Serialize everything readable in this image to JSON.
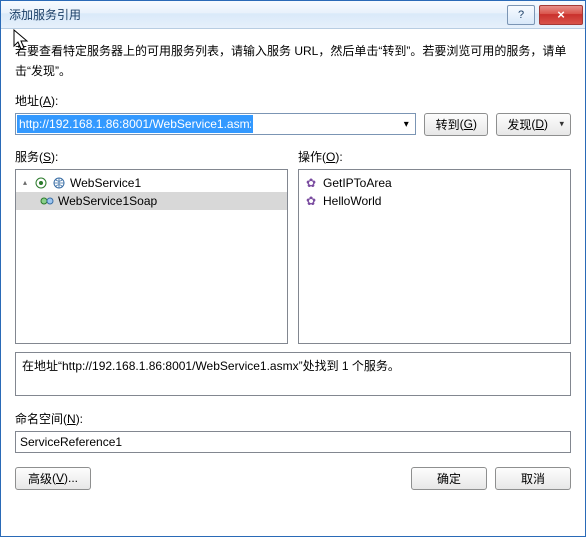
{
  "titlebar": {
    "title": "添加服务引用",
    "help_symbol": "?",
    "close_symbol": "×"
  },
  "intro": "若要查看特定服务器上的可用服务列表，请输入服务 URL，然后单击“转到”。若要浏览可用的服务，请单击“发现”。",
  "address": {
    "label_text": "地址",
    "label_key": "A",
    "value": "http://192.168.1.86:8001/WebService1.asmx",
    "go_label": "转到",
    "go_key": "G",
    "discover_label": "发现",
    "discover_key": "D"
  },
  "services": {
    "label_text": "服务",
    "label_key": "S",
    "tree": {
      "root": "WebService1",
      "child": "WebService1Soap"
    }
  },
  "operations": {
    "label_text": "操作",
    "label_key": "O",
    "items": [
      "GetIPToArea",
      "HelloWorld"
    ]
  },
  "status": "在地址“http://192.168.1.86:8001/WebService1.asmx”处找到 1 个服务。",
  "namespace": {
    "label_text": "命名空间",
    "label_key": "N",
    "value": "ServiceReference1"
  },
  "footer": {
    "advanced_label": "高级",
    "advanced_key": "V",
    "ok": "确定",
    "cancel": "取消"
  }
}
